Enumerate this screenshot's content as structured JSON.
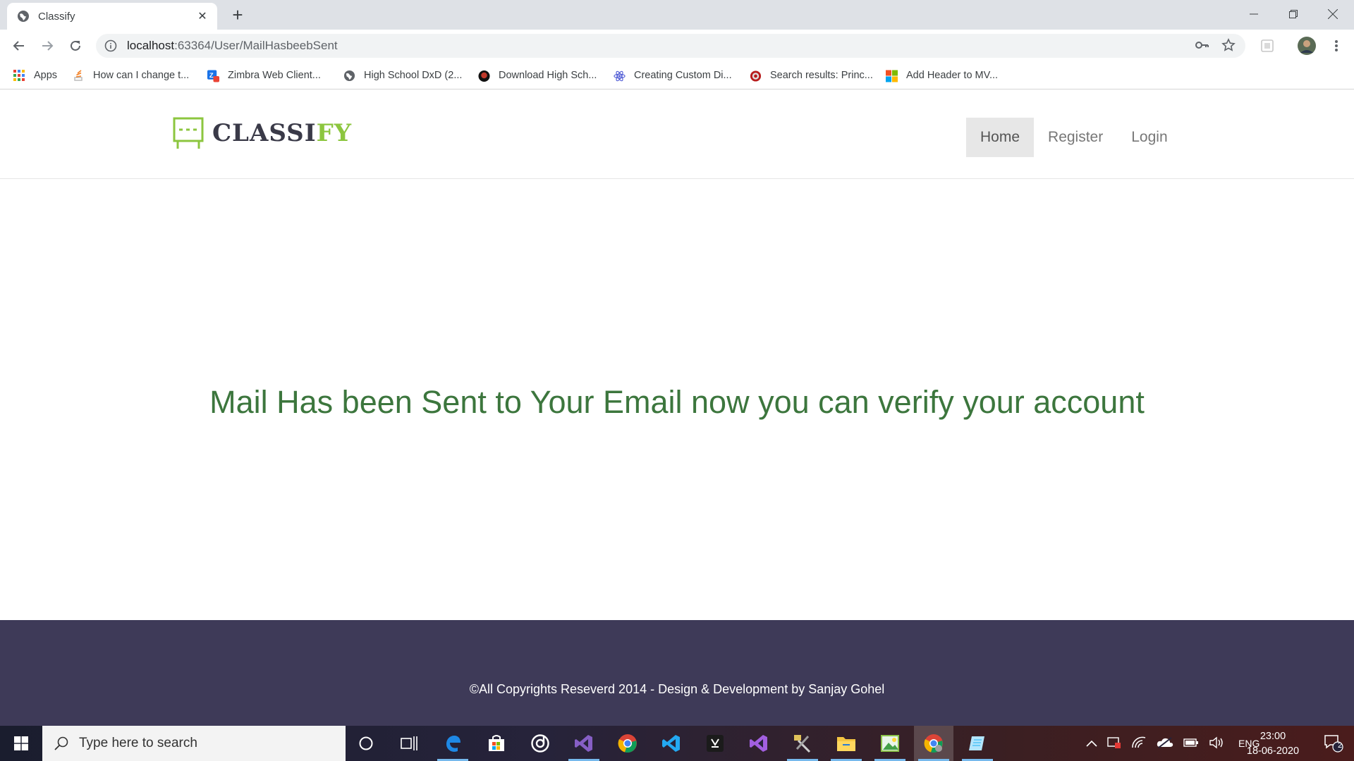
{
  "browser": {
    "tab_title": "Classify",
    "url_host": "localhost",
    "url_path": ":63364/User/MailHasbeebSent",
    "bookmarks": [
      {
        "label": "Apps",
        "icon": "apps-grid-icon"
      },
      {
        "label": "How can I change t...",
        "icon": "stackoverflow-icon"
      },
      {
        "label": "Zimbra Web Client...",
        "icon": "zimbra-icon"
      },
      {
        "label": "High School DxD (2...",
        "icon": "globe-icon"
      },
      {
        "label": "Download High Sch...",
        "icon": "site-icon"
      },
      {
        "label": "Creating Custom Di...",
        "icon": "react-icon"
      },
      {
        "label": "Search results: Princ...",
        "icon": "target-icon"
      },
      {
        "label": "Add Header to MV...",
        "icon": "microsoft-icon"
      }
    ]
  },
  "site": {
    "logo_text_main": "CLASSI",
    "logo_text_accent": "FY",
    "nav": [
      {
        "label": "Home",
        "active": true
      },
      {
        "label": "Register",
        "active": false
      },
      {
        "label": "Login",
        "active": false
      }
    ],
    "message": "Mail Has been Sent to Your Email now you can verify your account",
    "footer": "©All Copyrights Reseverd 2014 - Design & Development by Sanjay Gohel"
  },
  "taskbar": {
    "search_placeholder": "Type here to search",
    "language": "ENG",
    "time": "23:00",
    "date": "18-06-2020",
    "notification_count": "2",
    "apps": [
      "cortana-icon",
      "task-view-icon",
      "edge-icon",
      "store-icon",
      "groove-icon",
      "visual-studio-purple-icon",
      "chrome-icon",
      "vscode-icon",
      "unity-icon",
      "visual-studio-icon",
      "tools-icon",
      "file-explorer-icon",
      "image-editor-icon",
      "chrome-active-icon",
      "notes-icon"
    ]
  },
  "colors": {
    "accent_green": "#8cc63f",
    "message_green": "#3c763d",
    "footer_bg": "#3e3a58"
  }
}
